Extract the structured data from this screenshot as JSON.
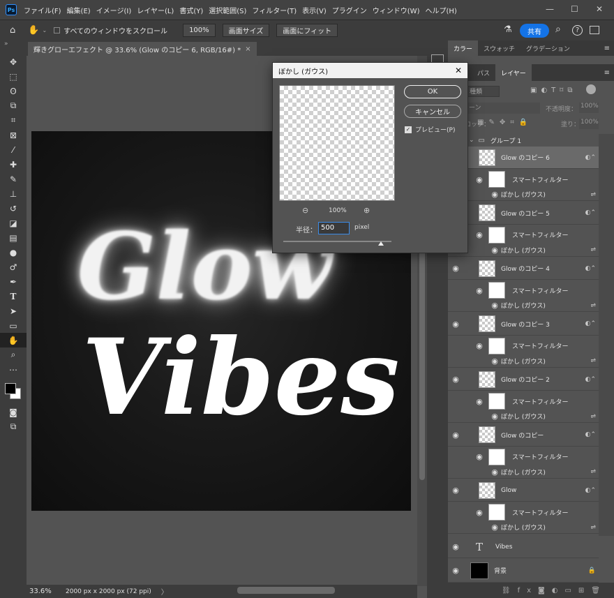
{
  "app": {
    "logo": "Ps"
  },
  "menu": [
    "ファイル(F)",
    "編集(E)",
    "イメージ(I)",
    "レイヤー(L)",
    "書式(Y)",
    "選択範囲(S)",
    "フィルター(T)",
    "表示(V)",
    "プラグイン",
    "ウィンドウ(W)",
    "ヘルプ(H)"
  ],
  "options": {
    "scroll_all_label": "すべてのウィンドウをスクロール",
    "zoom_100": "100%",
    "fit_screen": "画面サイズ",
    "fill_screen": "画面にフィット",
    "share": "共有"
  },
  "document": {
    "tab_title": "輝きグローエフェクト @ 33.6% (Glow のコピー 6, RGB/16#) *",
    "close": "×",
    "zoom": "33.6%",
    "size_info": "2000 px x 2000 px (72 ppi)",
    "arrow": "〉"
  },
  "artwork": {
    "line1": "Glow",
    "line2": "Vibes"
  },
  "dialog": {
    "title": "ぼかし (ガウス)",
    "ok": "OK",
    "cancel": "キャンセル",
    "preview_label": "プレビュー(P)",
    "zoom": "100%",
    "radius_label": "半径：",
    "radius_value": "500",
    "unit": "pixel",
    "slider_value": 0.9
  },
  "panel": {
    "top_tabs": [
      "カラー",
      "スウォッチ",
      "グラデーション"
    ],
    "layer_tabs": [
      "ネル",
      "パス",
      "レイヤー"
    ],
    "search": "種類",
    "blend_mode": "ーン",
    "opacity_label": "不透明度：",
    "opacity": "100%",
    "lock_label": "ロック：",
    "fill_label": "塗り：",
    "fill": "100%",
    "group_name": "グループ 1",
    "smart_filter_label": "スマートフィルター",
    "blur_label": "ぼかし (ガウス)",
    "layers": [
      {
        "name": "Glow のコピー 6"
      },
      {
        "name": "Glow のコピー 5"
      },
      {
        "name": "Glow のコピー 4"
      },
      {
        "name": "Glow のコピー 3"
      },
      {
        "name": "Glow のコピー 2"
      },
      {
        "name": "Glow のコピー"
      },
      {
        "name": "Glow"
      }
    ],
    "text_layer": "Vibes",
    "bg_layer": "背景"
  }
}
